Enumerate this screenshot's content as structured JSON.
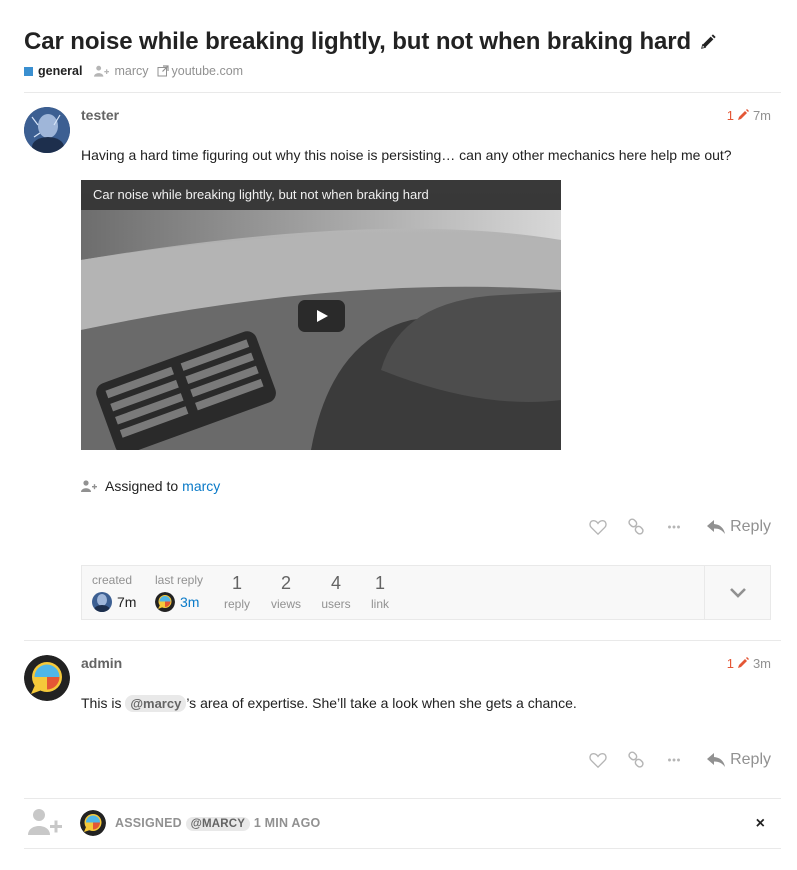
{
  "topic": {
    "title": "Car noise while breaking lightly, but not when braking hard",
    "category": "general",
    "category_color": "#3a8fd0",
    "assignee": "marcy",
    "domain": "youtube.com"
  },
  "posts": [
    {
      "username": "tester",
      "edit_count": "1",
      "age": "7m",
      "text": "Having a hard time figuring out why this noise is persisting… can any other mechanics here help me out?",
      "video_title": "Car noise while breaking lightly, but not when braking hard",
      "assigned_prefix": "Assigned to",
      "assigned_user": "marcy",
      "reply_label": "Reply"
    },
    {
      "username": "admin",
      "edit_count": "1",
      "age": "3m",
      "text_before": "This is",
      "mention": "@marcy",
      "text_after": "’s area of expertise. She’ll take a look when she gets a chance.",
      "reply_label": "Reply"
    }
  ],
  "topic_map": {
    "created_label": "created",
    "created_age": "7m",
    "last_reply_label": "last reply",
    "last_reply_age": "3m",
    "stats": [
      {
        "value": "1",
        "label": "reply"
      },
      {
        "value": "2",
        "label": "views"
      },
      {
        "value": "4",
        "label": "users"
      },
      {
        "value": "1",
        "label": "link"
      }
    ]
  },
  "small_action": {
    "action": "ASSIGNED",
    "mention": "@MARCY",
    "time": "1 MIN AGO",
    "close": "×"
  },
  "colors": {
    "accent_orange": "#e45735",
    "link_blue": "#0a7ac8",
    "muted": "#919191"
  }
}
